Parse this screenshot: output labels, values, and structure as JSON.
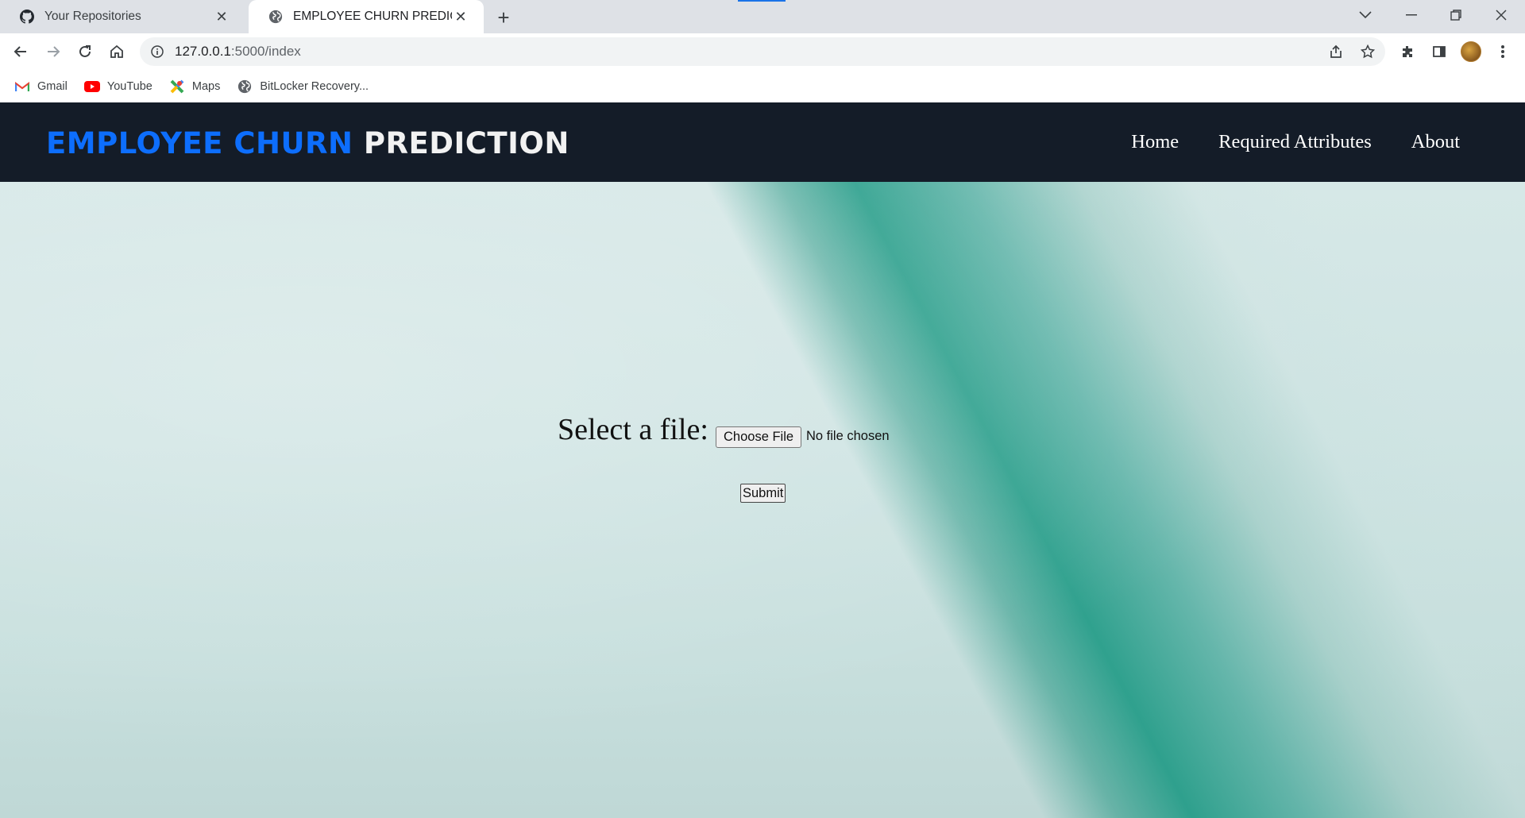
{
  "browser": {
    "tabs": [
      {
        "title": "Your Repositories",
        "icon": "github-icon"
      },
      {
        "title": "EMPLOYEE CHURN PREDICTION",
        "icon": "globe-icon"
      }
    ],
    "url": {
      "host": "127.0.0.1",
      "path": ":5000/index"
    },
    "bookmarks": [
      {
        "label": "Gmail",
        "icon": "gmail-icon"
      },
      {
        "label": "YouTube",
        "icon": "youtube-icon"
      },
      {
        "label": "Maps",
        "icon": "maps-icon"
      },
      {
        "label": "BitLocker Recovery...",
        "icon": "globe-icon"
      }
    ]
  },
  "navbar": {
    "brand_part1": "EMPLOYEE CHURN",
    "brand_part2": "PREDICTION",
    "links": [
      "Home",
      "Required Attributes",
      "About"
    ]
  },
  "upload_form": {
    "label": "Select a file:",
    "choose_button": "Choose File",
    "file_status": "No file chosen",
    "submit_button": "Submit"
  },
  "colors": {
    "navbar_bg": "#141c28",
    "brand_accent": "#0d6efd",
    "hero_teal": "#1f9480"
  }
}
